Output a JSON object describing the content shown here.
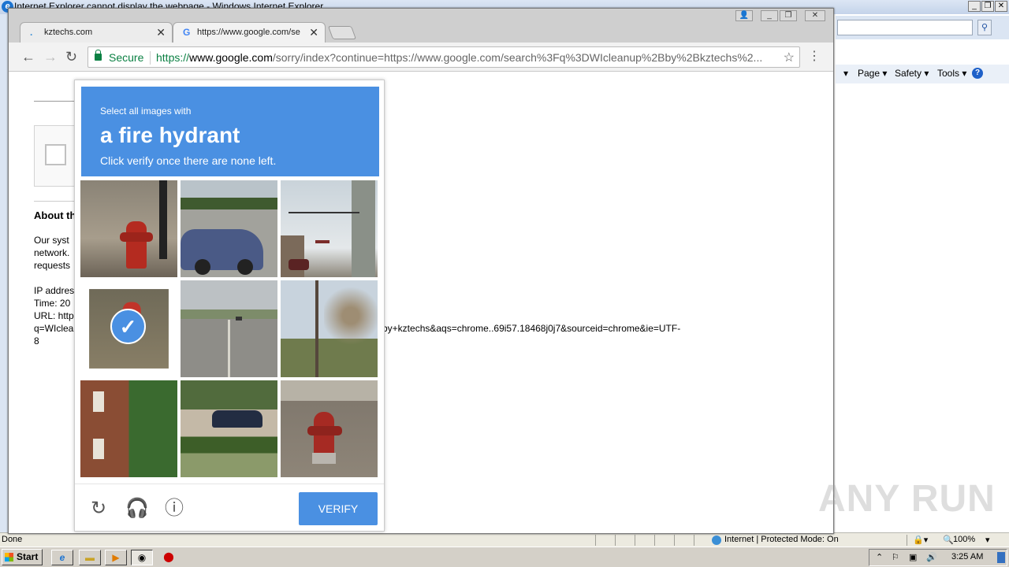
{
  "ie": {
    "title": "Internet Explorer cannot display the webpage - Windows Internet Explorer",
    "commands": [
      "Page ▾",
      "Safety ▾",
      "Tools ▾"
    ],
    "status_done": "Done",
    "status_zone": "Internet | Protected Mode: On",
    "status_zoom": "100%"
  },
  "chrome": {
    "tabs": [
      {
        "label": "kztechs.com",
        "active": false
      },
      {
        "label": "https://www.google.com/se",
        "active": true
      }
    ],
    "omnibox": {
      "secure_label": "Secure",
      "url_scheme": "https://",
      "url_host": "www.google.com",
      "url_rest": "/sorry/index?continue=https://www.google.com/search%3Fq%3DWIcleanup%2Bby%2Bkztechs%2..."
    }
  },
  "page": {
    "about_heading": "About th",
    "line1": "Our syst",
    "line2": "network.",
    "line3": "requests",
    "ip_label": "IP addres",
    "time_label": "Time: 20",
    "url_label": "URL: http",
    "url_q": "q=WIclea",
    "url_tail": "by+kztechs&aqs=chrome..69i57.18468j0j7&sourceid=chrome&ie=UTF-",
    "url_end": "8"
  },
  "captcha": {
    "instruction_pre": "Select all images with",
    "object": "a fire hydrant",
    "instruction_post": "Click verify once there are none left.",
    "verify_label": "VERIFY",
    "tiles": [
      {
        "name": "hydrant",
        "selected": false
      },
      {
        "name": "street-car",
        "selected": false
      },
      {
        "name": "traffic-light",
        "selected": false
      },
      {
        "name": "hydrant-grass",
        "selected": true
      },
      {
        "name": "highway",
        "selected": false
      },
      {
        "name": "tree",
        "selected": false
      },
      {
        "name": "building",
        "selected": false
      },
      {
        "name": "parked-car",
        "selected": false
      },
      {
        "name": "hydrant-2",
        "selected": false
      }
    ]
  },
  "taskbar": {
    "start_label": "Start",
    "clock": "3:25 AM"
  },
  "watermark": "ANY RUN",
  "colors": {
    "captcha_blue": "#4a90e2",
    "secure_green": "#0b8043"
  }
}
